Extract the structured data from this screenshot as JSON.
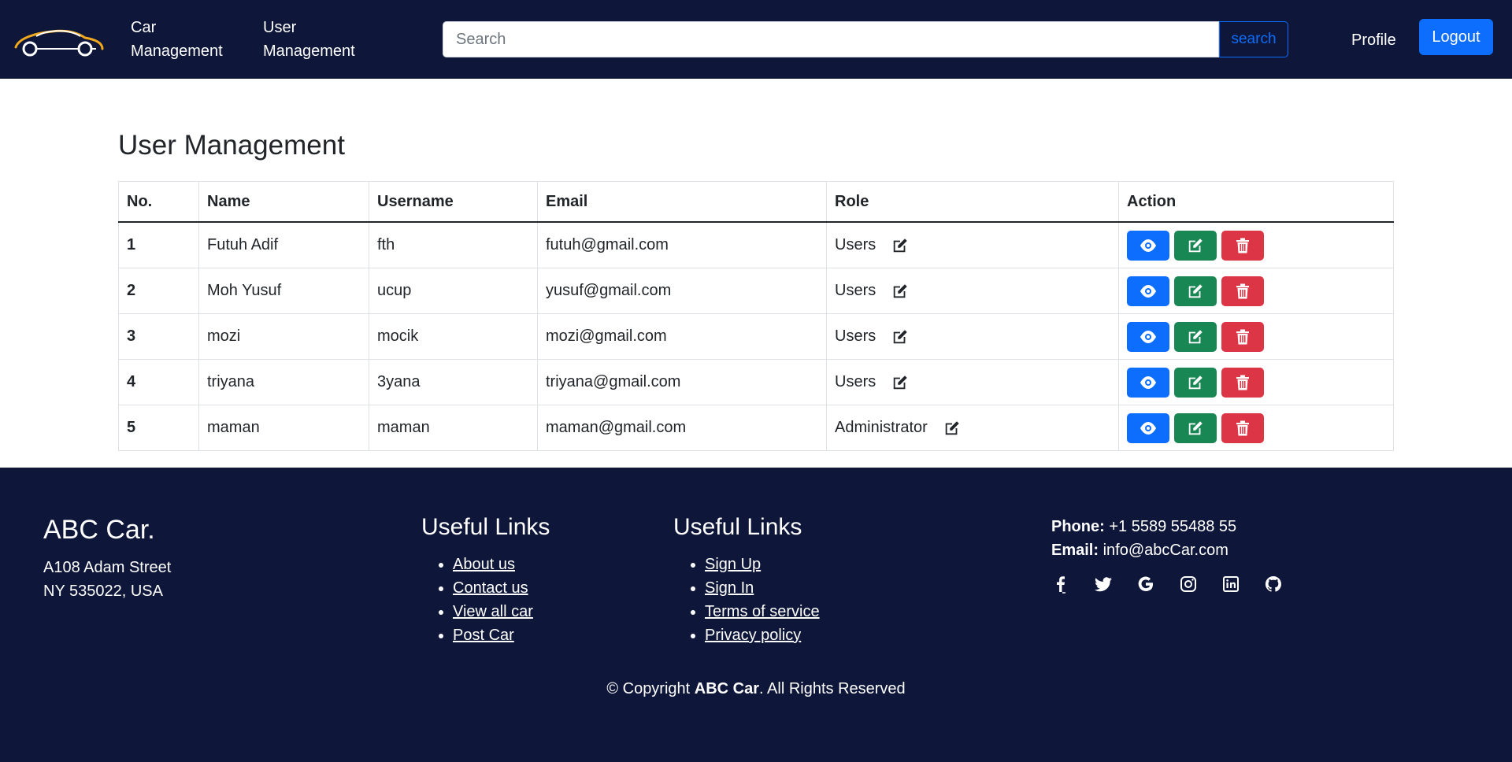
{
  "nav": {
    "logo_icon": "car-logo",
    "car_management": "Car Management",
    "user_management": "User Management",
    "search_placeholder": "Search",
    "search_button": "search",
    "profile": "Profile",
    "logout": "Logout"
  },
  "main": {
    "title": "User Management",
    "columns": [
      "No.",
      "Name",
      "Username",
      "Email",
      "Role",
      "Action"
    ],
    "rows": [
      {
        "no": "1",
        "name": "Futuh Adif",
        "username": "fth",
        "email": "futuh@gmail.com",
        "role": "Users"
      },
      {
        "no": "2",
        "name": "Moh Yusuf",
        "username": "ucup",
        "email": "yusuf@gmail.com",
        "role": "Users"
      },
      {
        "no": "3",
        "name": "mozi",
        "username": "mocik",
        "email": "mozi@gmail.com",
        "role": "Users"
      },
      {
        "no": "4",
        "name": "triyana",
        "username": "3yana",
        "email": "triyana@gmail.com",
        "role": "Users"
      },
      {
        "no": "5",
        "name": "maman",
        "username": "maman",
        "email": "maman@gmail.com",
        "role": "Administrator"
      }
    ],
    "action_icons": [
      "eye-icon",
      "edit-icon",
      "trash-icon"
    ]
  },
  "footer": {
    "brand": "ABC Car.",
    "address_line1": "A108 Adam Street",
    "address_line2": "NY 535022, USA",
    "links1": {
      "heading": "Useful Links",
      "items": [
        "About us",
        "Contact us",
        "View all car",
        "Post Car"
      ]
    },
    "links2": {
      "heading": "Useful Links",
      "items": [
        "Sign Up",
        "Sign In",
        "Terms of service",
        "Privacy policy"
      ]
    },
    "phone_label": "Phone:",
    "phone": "+1 5589 55488 55",
    "email_label": "Email:",
    "email": "info@abcCar.com",
    "social_icons": [
      "facebook-icon",
      "twitter-icon",
      "google-icon",
      "instagram-icon",
      "linkedin-icon",
      "github-icon"
    ],
    "copyright_prefix": "© Copyright",
    "copyright_brand": "ABC Car",
    "copyright_suffix": ". All Rights Reserved"
  },
  "colors": {
    "navy": "#0e1639",
    "primary": "#0d6efd",
    "success": "#198754",
    "danger": "#dc3545"
  }
}
